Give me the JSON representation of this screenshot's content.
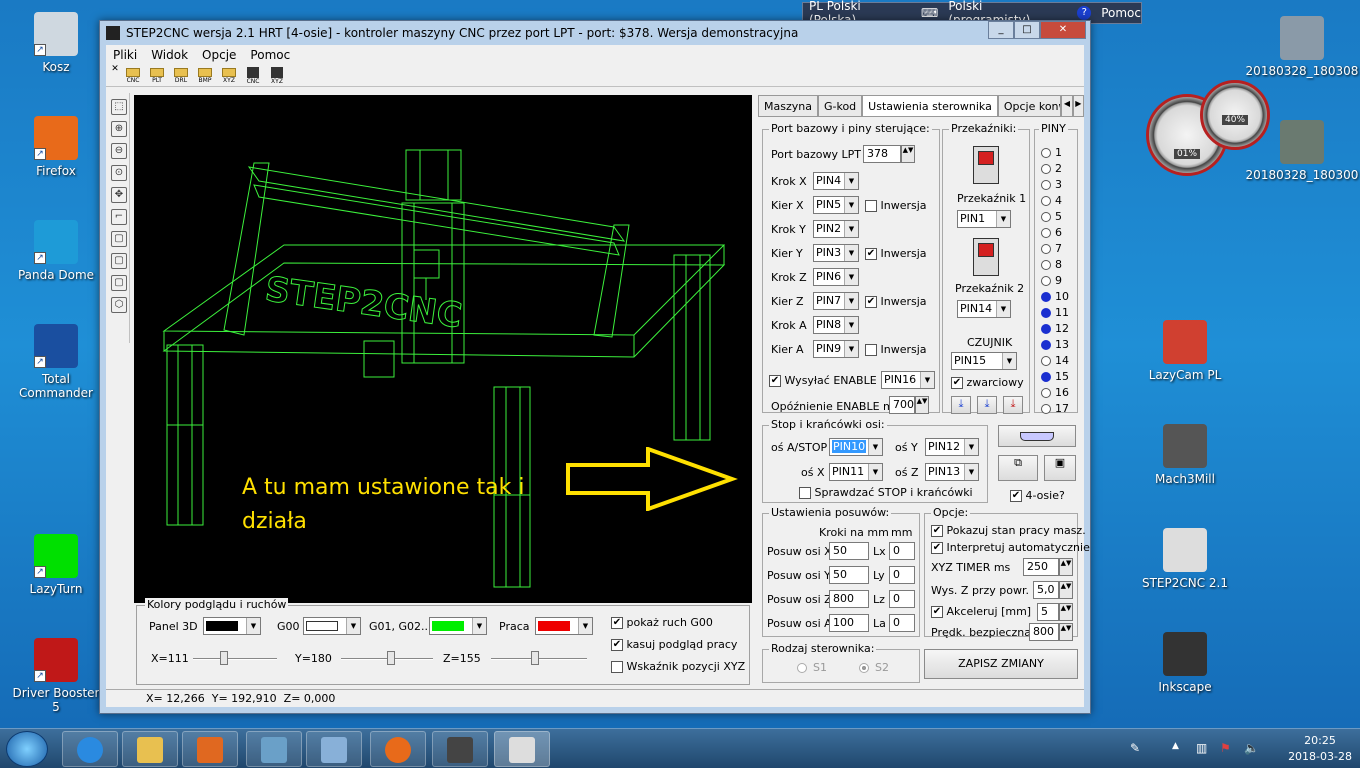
{
  "desktop": {
    "left_icons": [
      {
        "label": "Kosz",
        "color": "#cfd8e0"
      },
      {
        "label": "Firefox",
        "color": "#e86a1a"
      },
      {
        "label": "Panda Dome",
        "color": "#1e9bd7"
      },
      {
        "label": "Total Commander",
        "color": "#1a4fa0"
      },
      {
        "label": "LazyTurn",
        "color": "#00e000"
      },
      {
        "label": "Driver Booster 5",
        "color": "#c01818"
      }
    ],
    "right_icons": [
      {
        "label": "20180328_180308",
        "color": "#8a9aa8"
      },
      {
        "label": "20180328_180300",
        "color": "#6a7a70"
      },
      {
        "label": "LazyCam PL",
        "color": "#d04030"
      },
      {
        "label": "Mach3Mill",
        "color": "#555555"
      },
      {
        "label": "STEP2CNC 2.1",
        "color": "#dddddd"
      },
      {
        "label": "Inkscape",
        "color": "#333333"
      }
    ],
    "gauges": {
      "cpu": "01%",
      "memory": "40%"
    }
  },
  "langbar": {
    "language": "PL Polski (Polska)",
    "layout": "Polski (programisty)",
    "help": "Pomoc"
  },
  "window": {
    "title": "STEP2CNC wersja 2.1 HRT [4-osie] - kontroler maszyny CNC przez port LPT - port: $378. Wersja demonstracyjna",
    "menu": [
      "Pliki",
      "Widok",
      "Opcje",
      "Pomoc"
    ],
    "toolbar": [
      "CNC",
      "PLT",
      "DRL",
      "BMP",
      "XYZ",
      "CNC",
      "XYZ"
    ],
    "annotation_line1": "A tu mam ustawione tak i",
    "annotation_line2": "działa",
    "colors_group": {
      "title": "Kolory podglądu i ruchów",
      "panel3d_label": "Panel 3D",
      "g00_label": "G00",
      "g01_label": "G01, G02...",
      "praca_label": "Praca",
      "swatches": {
        "panel3d": "#000000",
        "g00": "#ffffff",
        "g01": "#00ee00",
        "praca": "#ee0000"
      },
      "x_label": "X=111",
      "y_label": "Y=180",
      "z_label": "Z=155",
      "x_level": 0.35,
      "y_level": 0.55,
      "z_level": 0.45,
      "show_g00": "pokaż ruch G00",
      "clear_preview": "kasuj podgląd pracy",
      "xyz_indicator": "Wskaźnik pozycji XYZ"
    },
    "status": {
      "x": "X=  12,266",
      "y": "Y= 192,910",
      "z": "Z=   0,000"
    }
  },
  "panel": {
    "tabs": [
      "Maszyna",
      "G-kod",
      "Ustawienia sterownika",
      "Opcje konwersji"
    ],
    "port_group": {
      "title": "Port bazowy i piny sterujące:",
      "port_label": "Port bazowy LPT $",
      "port_value": "378",
      "rows": [
        {
          "label": "Krok X",
          "pin": "PIN4"
        },
        {
          "label": "Kier X",
          "pin": "PIN5",
          "inv": "Inwersja",
          "checked": ""
        },
        {
          "label": "Krok Y",
          "pin": "PIN2"
        },
        {
          "label": "Kier Y",
          "pin": "PIN3",
          "inv": "Inwersja",
          "checked": "✔"
        },
        {
          "label": "Krok Z",
          "pin": "PIN6"
        },
        {
          "label": "Kier Z",
          "pin": "PIN7",
          "inv": "Inwersja",
          "checked": "✔"
        },
        {
          "label": "Krok A",
          "pin": "PIN8"
        },
        {
          "label": "Kier A",
          "pin": "PIN9",
          "inv": "Inwersja",
          "checked": ""
        }
      ],
      "enable_label": "Wysyłać ENABLE",
      "enable_pin": "PIN16",
      "delay_label": "Opóźnienie ENABLE ms",
      "delay_value": "700"
    },
    "relays": {
      "title": "Przekaźniki:",
      "relay1": "Przekaźnik 1",
      "relay1_pin": "PIN1",
      "relay2": "Przekaźnik 2",
      "relay2_pin": "PIN14",
      "sensor": "CZUJNIK",
      "sensor_pin": "PIN15",
      "shorted": "zwarciowy"
    },
    "pins": {
      "title": "PINY",
      "list": [
        {
          "n": "1",
          "on": false
        },
        {
          "n": "2",
          "on": false
        },
        {
          "n": "3",
          "on": false
        },
        {
          "n": "4",
          "on": false
        },
        {
          "n": "5",
          "on": false
        },
        {
          "n": "6",
          "on": false
        },
        {
          "n": "7",
          "on": false
        },
        {
          "n": "8",
          "on": false
        },
        {
          "n": "9",
          "on": false
        },
        {
          "n": "10",
          "on": true
        },
        {
          "n": "11",
          "on": true
        },
        {
          "n": "12",
          "on": true
        },
        {
          "n": "13",
          "on": true
        },
        {
          "n": "14",
          "on": false
        },
        {
          "n": "15",
          "on": true
        },
        {
          "n": "16",
          "on": false
        },
        {
          "n": "17",
          "on": false
        }
      ]
    },
    "stop_group": {
      "title": "Stop i krańcówki osi:",
      "a_stop_label": "oś A/STOP",
      "a_stop_pin": "PIN10",
      "y_label": "oś Y",
      "y_pin": "PIN12",
      "x_label": "oś X",
      "x_pin": "PIN11",
      "z_label": "oś Z",
      "z_pin": "PIN13",
      "check_label": "Sprawdzać STOP i krańcówki"
    },
    "four_axes": "4-osie?",
    "feed_group": {
      "title": "Ustawienia posuwów:",
      "col1": "Kroki na mm",
      "col2": "mm",
      "rows": [
        {
          "label": "Posuw osi X",
          "steps": "50",
          "l": "Lx",
          "mm": "0"
        },
        {
          "label": "Posuw osi Y",
          "steps": "50",
          "l": "Ly",
          "mm": "0"
        },
        {
          "label": "Posuw osi Z",
          "steps": "800",
          "l": "Lz",
          "mm": "0"
        },
        {
          "label": "Posuw osi A",
          "steps": "100",
          "l": "La",
          "mm": "0"
        }
      ]
    },
    "options": {
      "title": "Opcje:",
      "show_state": "Pokazuj stan pracy masz.",
      "interpret": "Interpretuj automatycznie",
      "timer_label": "XYZ TIMER ms",
      "timer_value": "250",
      "z_lift_label": "Wys. Z przy powr.",
      "z_lift_value": "5,0",
      "accel_label": "Akceleruj [mm]",
      "accel_value": "5",
      "safe_speed_label": "Prędk. bezpieczna",
      "safe_speed_value": "800"
    },
    "driver": {
      "title": "Rodzaj sterownika:",
      "s1": "S1",
      "s2": "S2"
    },
    "save_button": "ZAPISZ ZMIANY"
  },
  "taskbar": {
    "time": "20:25",
    "date": "2018-03-28"
  }
}
